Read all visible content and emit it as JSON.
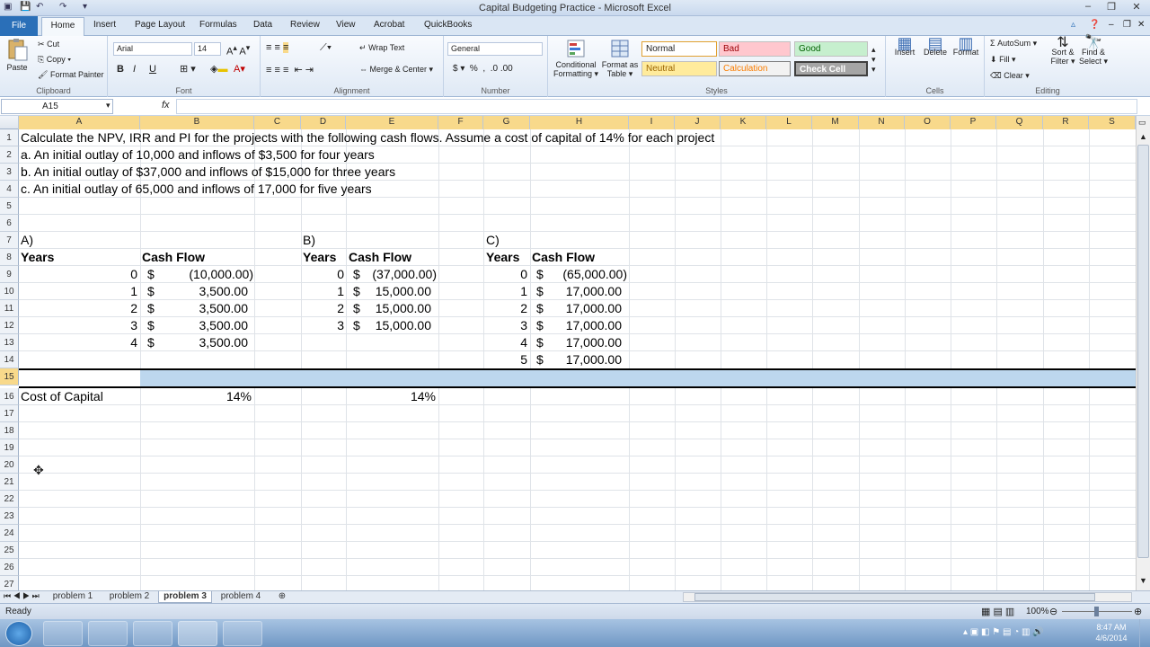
{
  "window": {
    "title": "Capital Budgeting Practice - Microsoft Excel"
  },
  "tabs": [
    "File",
    "Home",
    "Insert",
    "Page Layout",
    "Formulas",
    "Data",
    "Review",
    "View",
    "Acrobat",
    "QuickBooks"
  ],
  "ribbon": {
    "clipboard": {
      "label": "Clipboard",
      "paste": "Paste",
      "cut": "Cut",
      "copy": "Copy ▾",
      "format_painter": "Format Painter"
    },
    "font": {
      "label": "Font",
      "name": "Arial",
      "size": "14"
    },
    "alignment": {
      "label": "Alignment",
      "wrap": "Wrap Text",
      "merge": "Merge & Center ▾"
    },
    "number": {
      "label": "Number",
      "format": "General"
    },
    "styles": {
      "label": "Styles",
      "conditional": "Conditional Formatting ▾",
      "format_table": "Format as Table ▾",
      "normal": "Normal",
      "bad": "Bad",
      "good": "Good",
      "neutral": "Neutral",
      "calculation": "Calculation",
      "check_cell": "Check Cell"
    },
    "cells": {
      "label": "Cells",
      "insert": "Insert",
      "delete": "Delete",
      "format": "Format"
    },
    "editing": {
      "label": "Editing",
      "autosum": "AutoSum ▾",
      "fill": "Fill ▾",
      "clear": "Clear ▾",
      "sort": "Sort & Filter ▾",
      "find": "Find & Select ▾"
    }
  },
  "formula_bar": {
    "name_box": "A15",
    "fx": "fx",
    "content": ""
  },
  "columns": [
    "A",
    "B",
    "C",
    "D",
    "E",
    "F",
    "G",
    "H",
    "I",
    "J",
    "K",
    "L",
    "M",
    "N",
    "O",
    "P",
    "Q",
    "R",
    "S"
  ],
  "rows": [
    "1",
    "2",
    "3",
    "4",
    "5",
    "6",
    "7",
    "8",
    "9",
    "10",
    "11",
    "12",
    "13",
    "14",
    "15",
    "16",
    "17",
    "18",
    "19",
    "20",
    "21",
    "22",
    "23",
    "24",
    "25",
    "26",
    "27"
  ],
  "cells": {
    "r1": "Calculate the NPV, IRR and PI for the projects with the following cash flows.  Assume a cost of capital of 14% for each project",
    "r2": "a.  An initial outlay of 10,000 and inflows of $3,500 for four years",
    "r3": "b.  An initial outlay of $37,000 and inflows of $15,000 for three years",
    "r4": "c.  An initial outlay of 65,000 and inflows of 17,000 for five years",
    "a_label": "A)",
    "b_label": "B)",
    "c_label": "C)",
    "years": "Years",
    "cash_flow": "Cash Flow",
    "dollar": "$",
    "a_years": [
      "0",
      "1",
      "2",
      "3",
      "4"
    ],
    "a_values": [
      "(10,000.00)",
      "3,500.00",
      "3,500.00",
      "3,500.00",
      "3,500.00"
    ],
    "b_years": [
      "0",
      "1",
      "2",
      "3"
    ],
    "b_values": [
      "(37,000.00)",
      "15,000.00",
      "15,000.00",
      "15,000.00"
    ],
    "c_years": [
      "0",
      "1",
      "2",
      "3",
      "4",
      "5"
    ],
    "c_values": [
      "(65,000.00)",
      "17,000.00",
      "17,000.00",
      "17,000.00",
      "17,000.00",
      "17,000.00"
    ],
    "cost_of_capital": "Cost of Capital",
    "rate_b": "14%",
    "rate_e": "14%"
  },
  "sheets": [
    "problem 1",
    "problem 2",
    "problem 3",
    "problem 4"
  ],
  "active_sheet": "problem 3",
  "status": {
    "ready": "Ready",
    "zoom": "100%"
  },
  "clock": {
    "time": "8:47 AM",
    "date": "4/6/2014"
  },
  "colors": {
    "selection": "#bdd7ee",
    "header_selected": "#f8d98b",
    "file_tab": "#2a6fb8"
  }
}
